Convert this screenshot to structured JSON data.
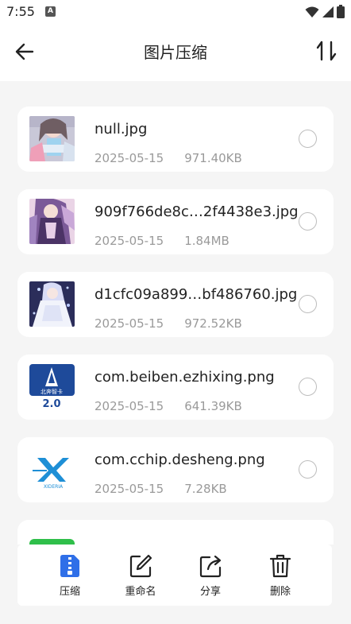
{
  "status_bar": {
    "time": "7:55",
    "notification_badge": "A",
    "icons": [
      "wifi-icon",
      "signal-icon",
      "battery-icon"
    ]
  },
  "header": {
    "title": "图片压缩",
    "back_icon": "arrow-left-icon",
    "sort_icon": "sort-arrows-icon"
  },
  "files": [
    {
      "name": "null.jpg",
      "date": "2025-05-15",
      "size": "971.40KB",
      "thumb": "anime-girl-blue-outfit"
    },
    {
      "name": "909f766de8c…2f4438e3.jpg",
      "date": "2025-05-15",
      "size": "1.84MB",
      "thumb": "anime-girl-purple-dress"
    },
    {
      "name": "d1cfc09a899…bf486760.jpg",
      "date": "2025-05-15",
      "size": "972.52KB",
      "thumb": "anime-girl-white-dress"
    },
    {
      "name": "com.beiben.ezhixing.png",
      "date": "2025-05-15",
      "size": "641.39KB",
      "thumb": "beiben-app-logo"
    },
    {
      "name": "com.cchip.desheng.png",
      "date": "2025-05-15",
      "size": "7.28KB",
      "thumb": "desheng-app-logo"
    }
  ],
  "thumb_text": {
    "beiben": {
      "line1": "北奔智卡",
      "line2": "2.0"
    },
    "desheng": {
      "brand": "XIDERIA"
    }
  },
  "actions": [
    {
      "label": "压缩",
      "icon": "zip-file-icon",
      "active": true
    },
    {
      "label": "重命名",
      "icon": "edit-icon",
      "active": false
    },
    {
      "label": "分享",
      "icon": "share-icon",
      "active": false
    },
    {
      "label": "删除",
      "icon": "trash-icon",
      "active": false
    }
  ],
  "colors": {
    "accent": "#2f6fe8",
    "background": "#f5f5f5",
    "card": "#ffffff",
    "meta_text": "#9a9a9a"
  }
}
